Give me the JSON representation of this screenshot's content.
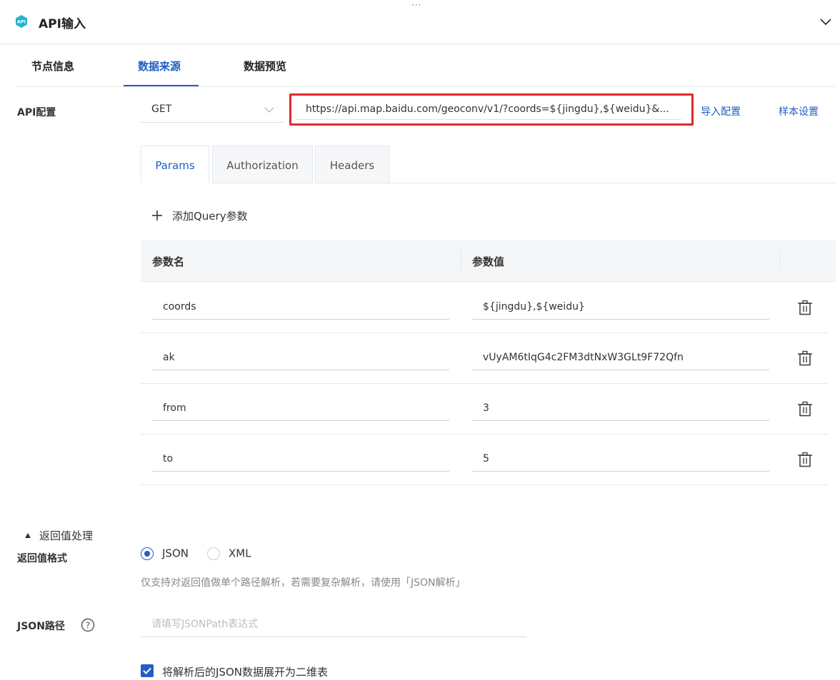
{
  "header": {
    "drag_handle": "···",
    "title": "API输入",
    "icon": "api-badge-icon",
    "collapse_icon": "chevron-down-icon"
  },
  "tabs": [
    "节点信息",
    "数据来源",
    "数据预览"
  ],
  "active_tab": "数据来源",
  "api_config": {
    "label": "API配置",
    "method": "GET",
    "url": "https://api.map.baidu.com/geoconv/v1/?coords=${jingdu},${weidu}&...",
    "import_link": "导入配置",
    "sample_link": "样本设置"
  },
  "sub_tabs": [
    "Params",
    "Authorization",
    "Headers"
  ],
  "active_sub_tab": "Params",
  "params": {
    "add_label": "添加Query参数",
    "columns": [
      "参数名",
      "参数值"
    ],
    "rows": [
      {
        "name": "coords",
        "value": "${jingdu},${weidu}"
      },
      {
        "name": "ak",
        "value": "vUyAM6tIqG4c2FM3dtNxW3GLt9F72Qfn"
      },
      {
        "name": "from",
        "value": "3"
      },
      {
        "name": "to",
        "value": "5"
      }
    ]
  },
  "return_section": {
    "toggle_label": "返回值处理",
    "format_label": "返回值格式",
    "options": [
      "JSON",
      "XML"
    ],
    "selected": "JSON",
    "hint": "仅支持对返回值做单个路径解析，若需要复杂解析，请使用「JSON解析」",
    "json_path_label": "JSON路径",
    "json_path_placeholder": "请填写JSONPath表达式",
    "expand_label": "将解析后的JSON数据展开为二维表",
    "expand_checked": true
  },
  "colors": {
    "accent": "#1f5fc4",
    "highlight": "#e0282b",
    "icon_teal": "#28b3c9"
  }
}
